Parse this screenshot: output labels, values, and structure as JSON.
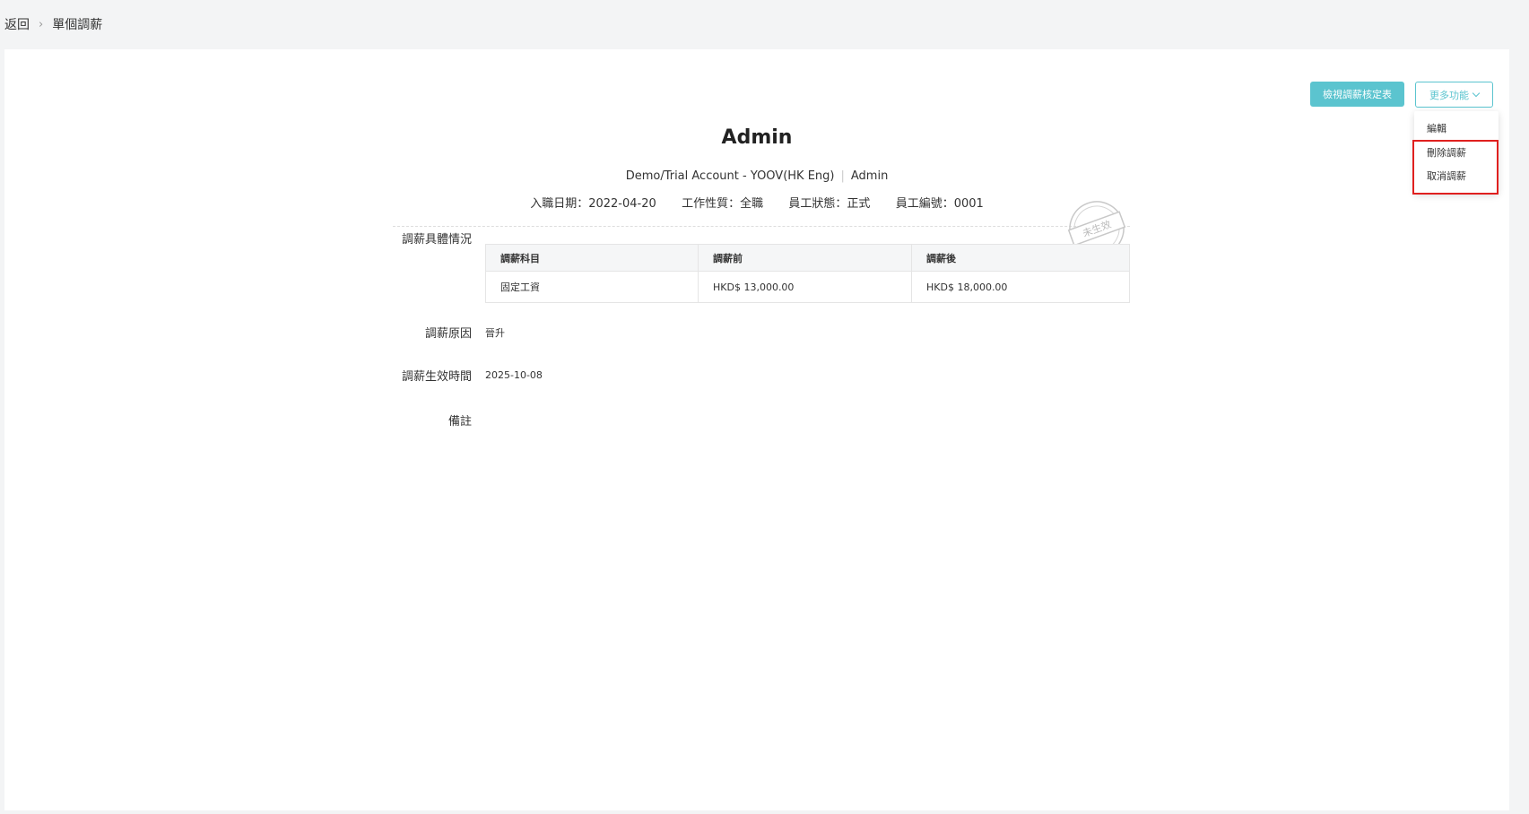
{
  "breadcrumb": {
    "back": "返回",
    "current": "單個調薪"
  },
  "toolbar": {
    "view_approval_label": "檢視調薪核定表",
    "more_label": "更多功能"
  },
  "more_menu": {
    "items": [
      {
        "label": "編輯"
      },
      {
        "label": "刪除調薪"
      },
      {
        "label": "取消調薪"
      }
    ]
  },
  "employee": {
    "name": "Admin",
    "company": "Demo/Trial Account - YOOV(HK Eng)",
    "position": "Admin",
    "join_date_label": "入職日期：",
    "join_date": "2022-04-20",
    "work_type_label": "工作性質：",
    "work_type": "全職",
    "status_label": "員工狀態：",
    "status": "正式",
    "number_label": "員工編號：",
    "number": "0001"
  },
  "stamp": {
    "text": "未生效"
  },
  "details": {
    "label": "調薪具體情況",
    "table": {
      "headers": [
        "調薪科目",
        "調薪前",
        "調薪後"
      ],
      "rows": [
        [
          "固定工資",
          "HKD$ 13,000.00",
          "HKD$ 18,000.00"
        ]
      ]
    }
  },
  "reason": {
    "label": "調薪原因",
    "value": "晉升"
  },
  "effective": {
    "label": "調薪生效時間",
    "value": "2025-10-08"
  },
  "remarks": {
    "label": "備註",
    "value": ""
  },
  "colors": {
    "accent": "#5bc4cf",
    "highlight": "#e0201f"
  }
}
